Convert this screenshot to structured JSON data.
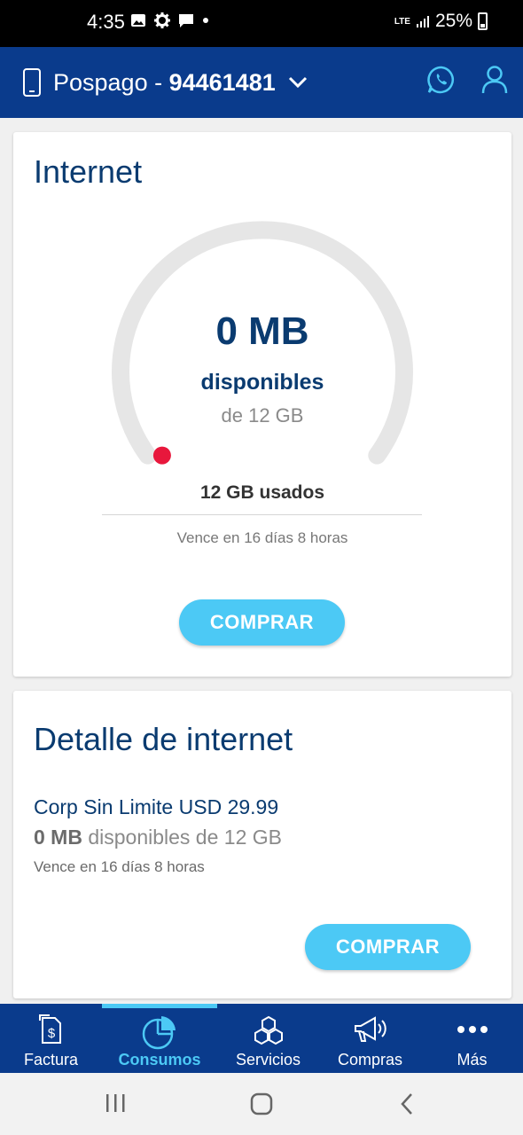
{
  "status_bar": {
    "time": "4:35",
    "network": "LTE",
    "battery": "25%"
  },
  "header": {
    "plan_prefix": "Pospago - ",
    "plan_number": "94461481"
  },
  "internet_card": {
    "title": "Internet",
    "available_value": "0 MB",
    "available_label": "disponibles",
    "total": "de 12 GB",
    "used": "12 GB usados",
    "expiry": "Vence en 16 días 8 horas",
    "buy_label": "COMPRAR",
    "remaining_fraction": 0
  },
  "detail_card": {
    "title": "Detalle de internet",
    "plan_name": "Corp Sin Limite USD 29.99",
    "available_value": "0 MB",
    "available_rest": " disponibles de 12 GB",
    "expiry": "Vence en 16 días 8 horas",
    "buy_label": "COMPRAR"
  },
  "bottom_nav": {
    "items": [
      {
        "label": "Factura",
        "icon": "invoice-icon",
        "active": false
      },
      {
        "label": "Consumos",
        "icon": "pie-chart-icon",
        "active": true
      },
      {
        "label": "Servicios",
        "icon": "hexagons-icon",
        "active": false
      },
      {
        "label": "Compras",
        "icon": "megaphone-icon",
        "active": false
      },
      {
        "label": "Más",
        "icon": "more-dots-icon",
        "active": false
      }
    ]
  },
  "colors": {
    "primary": "#0a3b8c",
    "accent": "#4cc9f5",
    "gauge_dot": "#e8173c",
    "title": "#0a3b70"
  }
}
